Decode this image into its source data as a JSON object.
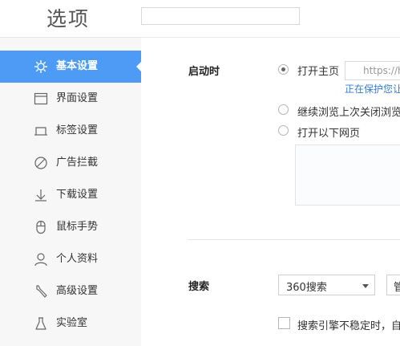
{
  "header": {
    "title": "选项",
    "search_placeholder": ""
  },
  "sidebar": {
    "items": [
      {
        "label": "基本设置",
        "icon": "gear-icon",
        "active": true
      },
      {
        "label": "界面设置",
        "icon": "window-icon"
      },
      {
        "label": "标签设置",
        "icon": "tab-icon"
      },
      {
        "label": "广告拦截",
        "icon": "block-icon"
      },
      {
        "label": "下载设置",
        "icon": "download-icon"
      },
      {
        "label": "鼠标手势",
        "icon": "mouse-icon"
      },
      {
        "label": "个人资料",
        "icon": "user-icon"
      },
      {
        "label": "高级设置",
        "icon": "wrench-icon"
      },
      {
        "label": "实验室",
        "icon": "flask-icon"
      }
    ]
  },
  "startup": {
    "label": "启动时",
    "options": [
      {
        "label": "打开主页",
        "checked": true
      },
      {
        "label": "继续浏览上次关闭浏览"
      },
      {
        "label": "打开以下网页"
      }
    ],
    "homepage_url": "https://h",
    "protect_link": "正在保护您让"
  },
  "search": {
    "label": "搜索",
    "engine": "360搜索",
    "manage_button": "管",
    "fallback_label": "搜索引擎不稳定时，自"
  },
  "colors": {
    "accent": "#4d9bf5",
    "link": "#3a7bd5",
    "sidebar_bg": "#f7f7f7"
  }
}
